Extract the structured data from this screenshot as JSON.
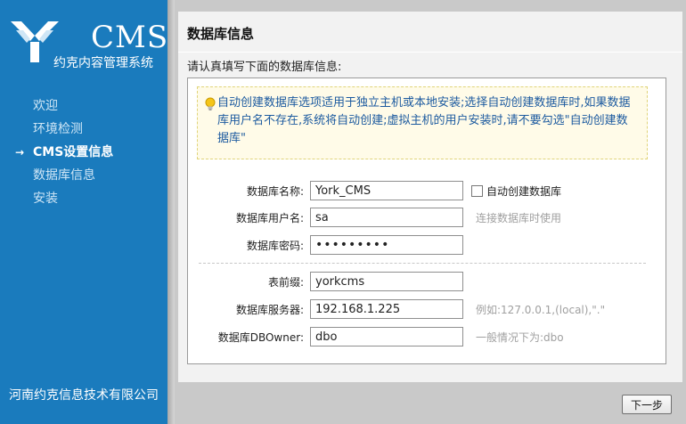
{
  "app": {
    "brand": "CMS",
    "brand_sub": "约克内容管理系统",
    "company": "河南约克信息技术有限公司"
  },
  "nav": {
    "items": [
      {
        "label": "欢迎",
        "active": false
      },
      {
        "label": "环境检测",
        "active": false
      },
      {
        "label": "CMS设置信息",
        "active": true
      },
      {
        "label": "数据库信息",
        "active": false
      },
      {
        "label": "安装",
        "active": false
      }
    ],
    "active_marker": "→"
  },
  "main": {
    "title": "数据库信息",
    "instruction": "请认真填写下面的数据库信息:",
    "tip": "自动创建数据库选项适用于独立主机或本地安装;选择自动创建数据库时,如果数据库用户名不存在,系统将自动创建;虚拟主机的用户安装时,请不要勾选\"自动创建数据库\""
  },
  "form": {
    "db_name": {
      "label": "数据库名称:",
      "value": "York_CMS"
    },
    "auto_create": {
      "label": "自动创建数据库",
      "checked": false
    },
    "db_user": {
      "label": "数据库用户名:",
      "value": "sa",
      "hint": "连接数据库时使用"
    },
    "db_password": {
      "label": "数据库密码:",
      "value": "123456789"
    },
    "table_prefix": {
      "label": "表前缀:",
      "value": "yorkcms"
    },
    "db_server": {
      "label": "数据库服务器:",
      "value": "192.168.1.225",
      "hint": "例如:127.0.0.1,(local),\".\""
    },
    "db_owner": {
      "label": "数据库DBOwner:",
      "value": "dbo",
      "hint": "一般情况下为:dbo"
    }
  },
  "actions": {
    "next_label": "下一步"
  },
  "colors": {
    "sidebar": "#1a7bbd",
    "tip_text": "#1c5a9f",
    "tip_bg": "#fffbe8"
  },
  "icons": {
    "logo": "logo-icon",
    "tip": "lightbulb-icon"
  }
}
